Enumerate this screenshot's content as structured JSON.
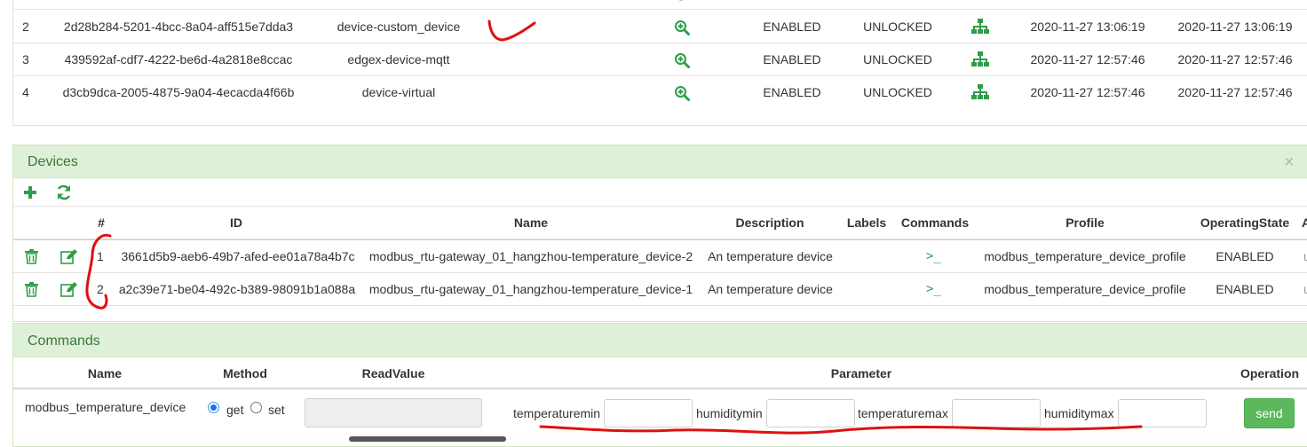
{
  "services": {
    "rows": [
      {
        "index": "2",
        "id": "2d28b284-5201-4bcc-8a04-aff515e7dda3",
        "name": "device-custom_device",
        "operating": "ENABLED",
        "admin": "UNLOCKED",
        "created": "2020-11-27 13:06:19",
        "modified": "2020-11-27 13:06:19"
      },
      {
        "index": "3",
        "id": "439592af-cdf7-4222-be6d-4a2818e8ccac",
        "name": "edgex-device-mqtt",
        "operating": "ENABLED",
        "admin": "UNLOCKED",
        "created": "2020-11-27 12:57:46",
        "modified": "2020-11-27 12:57:46"
      },
      {
        "index": "4",
        "id": "d3cb9dca-2005-4875-9a04-4ecacda4f66b",
        "name": "device-virtual",
        "operating": "ENABLED",
        "admin": "UNLOCKED",
        "created": "2020-11-27 12:57:46",
        "modified": "2020-11-27 12:57:46"
      }
    ]
  },
  "devices": {
    "title": "Devices",
    "close": "×",
    "headers": {
      "index": "#",
      "id": "ID",
      "name": "Name",
      "description": "Description",
      "labels": "Labels",
      "commands": "Commands",
      "profile": "Profile",
      "operating": "OperatingState"
    },
    "command_glyph": ">_",
    "rows": [
      {
        "index": "1",
        "id": "3661d5b9-aeb6-49b7-afed-ee01a78a4b7c",
        "name": "modbus_rtu-gateway_01_hangzhou-temperature_device-2",
        "description": "An temperature device",
        "profile": "modbus_temperature_device_profile",
        "operating": "ENABLED"
      },
      {
        "index": "2",
        "id": "a2c39e71-be04-492c-b389-98091b1a088a",
        "name": "modbus_rtu-gateway_01_hangzhou-temperature_device-1",
        "description": "An temperature device",
        "profile": "modbus_temperature_device_profile",
        "operating": "ENABLED"
      }
    ]
  },
  "commands": {
    "title": "Commands",
    "headers": {
      "name": "Name",
      "method": "Method",
      "readvalue": "ReadValue",
      "parameter": "Parameter",
      "operation": "Operation"
    },
    "row": {
      "name": "modbus_temperature_device",
      "method_get": "get",
      "method_set": "set",
      "params": [
        "temperaturemin",
        "humiditymin",
        "temperaturemax",
        "humiditymax"
      ],
      "send": "send"
    }
  },
  "colors": {
    "accent": "#3c763d",
    "icon": "#2e9e48",
    "annotation": "#dd1111",
    "panel": "#dff0d8"
  },
  "icons": [
    "zoom-in-icon",
    "sitemap-icon",
    "plus-icon",
    "refresh-icon",
    "trash-icon",
    "edit-icon",
    "terminal-icon",
    "close-icon"
  ]
}
